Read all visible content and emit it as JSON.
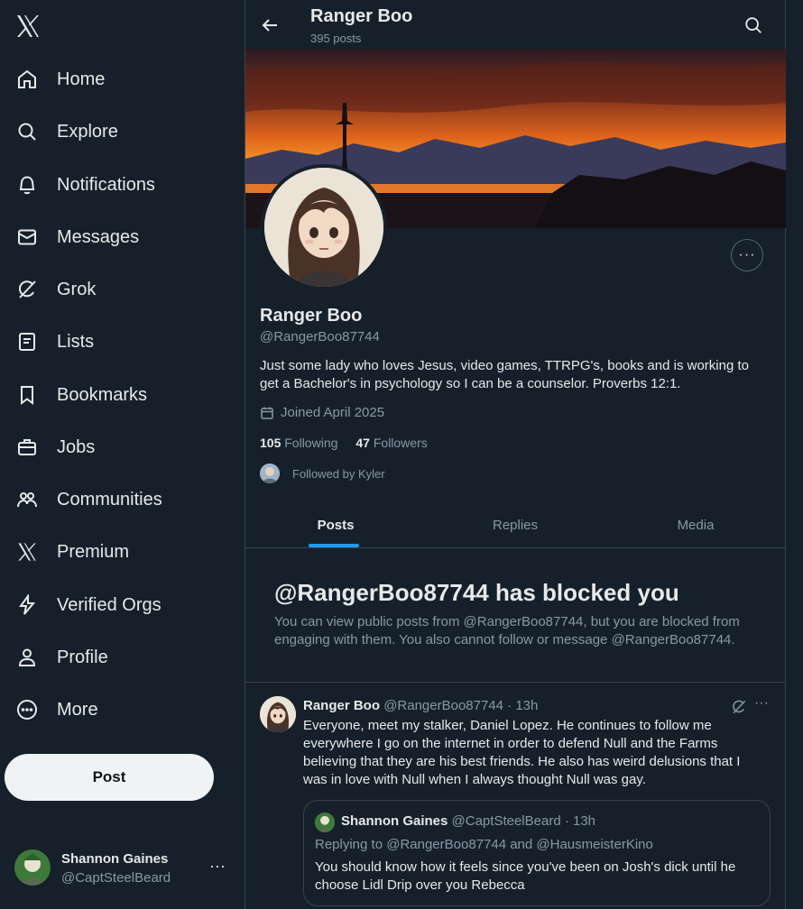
{
  "sidebar": {
    "logo": "x-logo-icon",
    "items": [
      {
        "label": "Home",
        "icon": "home-icon"
      },
      {
        "label": "Explore",
        "icon": "search-icon"
      },
      {
        "label": "Notifications",
        "icon": "bell-icon"
      },
      {
        "label": "Messages",
        "icon": "envelope-icon"
      },
      {
        "label": "Grok",
        "icon": "grok-icon"
      },
      {
        "label": "Lists",
        "icon": "list-icon"
      },
      {
        "label": "Bookmarks",
        "icon": "bookmark-icon"
      },
      {
        "label": "Jobs",
        "icon": "briefcase-icon"
      },
      {
        "label": "Communities",
        "icon": "people-icon"
      },
      {
        "label": "Premium",
        "icon": "x-logo-icon"
      },
      {
        "label": "Verified Orgs",
        "icon": "lightning-icon"
      },
      {
        "label": "Profile",
        "icon": "person-icon"
      },
      {
        "label": "More",
        "icon": "more-circle-icon"
      }
    ],
    "post_button": "Post",
    "account": {
      "name": "Shannon Gaines",
      "handle": "@CaptSteelBeard",
      "more": "···"
    }
  },
  "header": {
    "title": "Ranger Boo",
    "post_count": "395 posts"
  },
  "profile": {
    "more": "···",
    "name": "Ranger Boo",
    "handle": "@RangerBoo87744",
    "bio": "Just some lady who loves Jesus, video games, TTRPG's, books and is working to get a Bachelor's in psychology so I can be a counselor. Proverbs 12:1.",
    "joined": "Joined April 2025",
    "following_count": "105",
    "following_label": "Following",
    "followers_count": "47",
    "followers_label": "Followers",
    "followed_by": "Followed by Kyler"
  },
  "tabs": [
    {
      "label": "Posts",
      "active": true
    },
    {
      "label": "Replies",
      "active": false
    },
    {
      "label": "Media",
      "active": false
    }
  ],
  "blocked": {
    "title": "@RangerBoo87744 has blocked you",
    "text": "You can view public posts from @RangerBoo87744, but you are blocked from engaging with them. You also cannot follow or message @RangerBoo87744."
  },
  "tweet": {
    "name": "Ranger Boo",
    "handle_time": "@RangerBoo87744 · 13h",
    "more": "···",
    "text": "Everyone, meet my stalker, Daniel Lopez. He continues to follow me everywhere I go on the internet in order to defend Null and the Farms believing that they are his  best friends. He also has weird delusions that I was in love with Null when I always thought Null was gay.",
    "quote": {
      "name": "Shannon Gaines",
      "handle_time": "@CaptSteelBeard · 13h",
      "replying_to": "Replying to @RangerBoo87744 and @HausmeisterKino",
      "text": "You should know how it feels since you've been on Josh's dick until he choose Lidl Drip over you Rebecca"
    }
  },
  "colors": {
    "background": "#15202b",
    "accent": "#1d9bf0",
    "muted_text": "#8b98a5",
    "border": "#38444d"
  }
}
